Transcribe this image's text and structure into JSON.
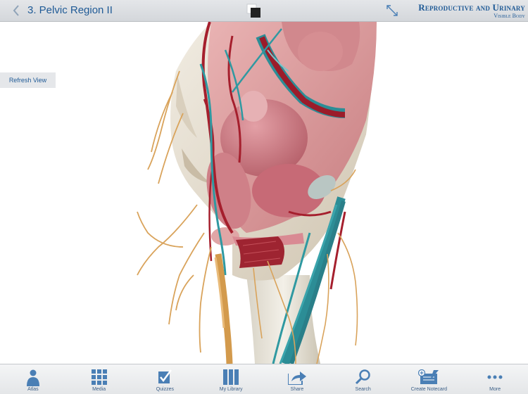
{
  "header": {
    "title": "3. Pelvic Region II",
    "brand_title": "Reproductive and Urinary",
    "brand_subtitle": "Visible Body"
  },
  "viewport": {
    "refresh_label": "Refresh View"
  },
  "tabs": [
    {
      "label": "Atlas",
      "icon": "person-icon"
    },
    {
      "label": "Media",
      "icon": "grid-icon"
    },
    {
      "label": "Quizzes",
      "icon": "checkbox-icon"
    },
    {
      "label": "My Library",
      "icon": "library-icon"
    },
    {
      "label": "Share",
      "icon": "share-icon"
    },
    {
      "label": "Search",
      "icon": "search-icon"
    },
    {
      "label": "Create Notecard",
      "icon": "notecard-icon"
    },
    {
      "label": "More",
      "icon": "more-icon"
    }
  ],
  "colors": {
    "accent": "#1f5a96",
    "toolbar": "#dcdfe2",
    "tab_icon": "#4a7fb5"
  }
}
